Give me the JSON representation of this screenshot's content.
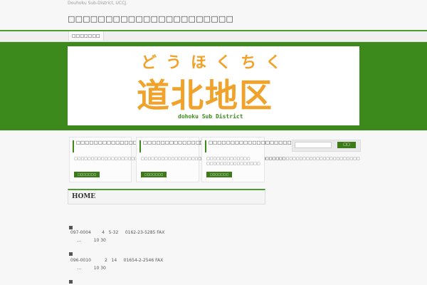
{
  "header": {
    "tagline": "Douhoku Sub-District, UCCJ.",
    "site_title": "□□□□□□□□□□□□□□□□□□□□□□"
  },
  "nav": {
    "items": [
      {
        "label": "□□□□□□□"
      }
    ]
  },
  "banner": {
    "kana": "どうほくちく",
    "kanji": "道北地区",
    "subtitle": "dohoku Sub District",
    "colors": {
      "orange": "#f0a22b",
      "green": "#3c8a1c"
    }
  },
  "cards": [
    {
      "title": "□□□□□□□□□□□□□□□□□□□□□□□□□□□□□□□",
      "text": "□□□□□□□□□□□□□□□□□□□□□□□□□□□□□□□□□□□□□□□□□□□□□□□□□□□□□□□□□□□□□□□□□□□□□□□□□□□□□□□□□□□□□",
      "more_label": "□□□□□□□"
    },
    {
      "title": "□□□□□□□□□□□□□□□□□□□□□□□□□□□□",
      "text": "□□□□□□□□□□□□□□□□□□□□□□□□□□□□□□□□□□□□□□□□□□□",
      "more_label": "□□□□□□□"
    },
    {
      "title": "□□□□□□□□□□□□□□□□□□□□□□",
      "text": "□□□□□□□□□□□□□ □□□□□□□□□□□□□□□□",
      "more_label": "□□□□□□□"
    }
  ],
  "search": {
    "placeholder": "",
    "button_label": "□□"
  },
  "home": {
    "title": "HOME",
    "entries": [
      {
        "bullet": "■",
        "address": "097-0004        4   5-32     0162-23-5285 FAX",
        "hours": "     …         10 30"
      },
      {
        "bullet": "■",
        "address": "096-0010          2   14     01654-2-2546 FAX",
        "hours": "     …         10 30"
      },
      {
        "bullet": "■"
      }
    ]
  }
}
